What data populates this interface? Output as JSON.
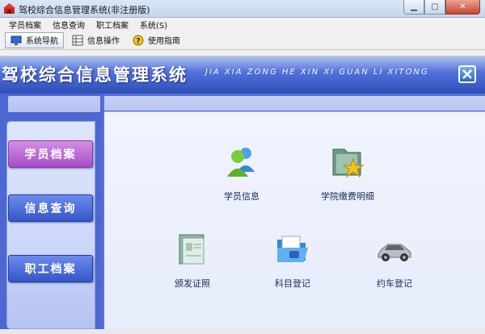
{
  "window": {
    "title": "驾校综合信息管理系统(非注册版)",
    "controls": [
      "minimize",
      "maximize",
      "close"
    ]
  },
  "menu": {
    "items": [
      "学员档案",
      "信息查询",
      "职工档案",
      "系统(S)"
    ]
  },
  "toolbar": {
    "buttons": [
      {
        "label": "系统导航",
        "icon": "monitor-icon",
        "active": true
      },
      {
        "label": "信息操作",
        "icon": "grid-icon",
        "active": false
      },
      {
        "label": "使用指南",
        "icon": "help-icon",
        "active": false
      }
    ]
  },
  "banner": {
    "title": "驾校综合信息管理系统",
    "subtitle": "JIA XIA ZONG HE XIN XI GUAN LI XITONG"
  },
  "sidebar": {
    "buttons": [
      "学员档案",
      "信息查询",
      "职工档案"
    ]
  },
  "content": {
    "items": [
      {
        "label": "学员信息",
        "icon": "users-icon"
      },
      {
        "label": "学院缴费明细",
        "icon": "star-folder-icon"
      },
      {
        "label": "颁发证照",
        "icon": "certificate-icon"
      },
      {
        "label": "科目登记",
        "icon": "folder-open-icon"
      },
      {
        "label": "约车登记",
        "icon": "car-icon"
      }
    ]
  },
  "colors": {
    "banner": "#506fd8",
    "sidebar_active": "#a64cc6",
    "sidebar_button": "#3356c8"
  }
}
